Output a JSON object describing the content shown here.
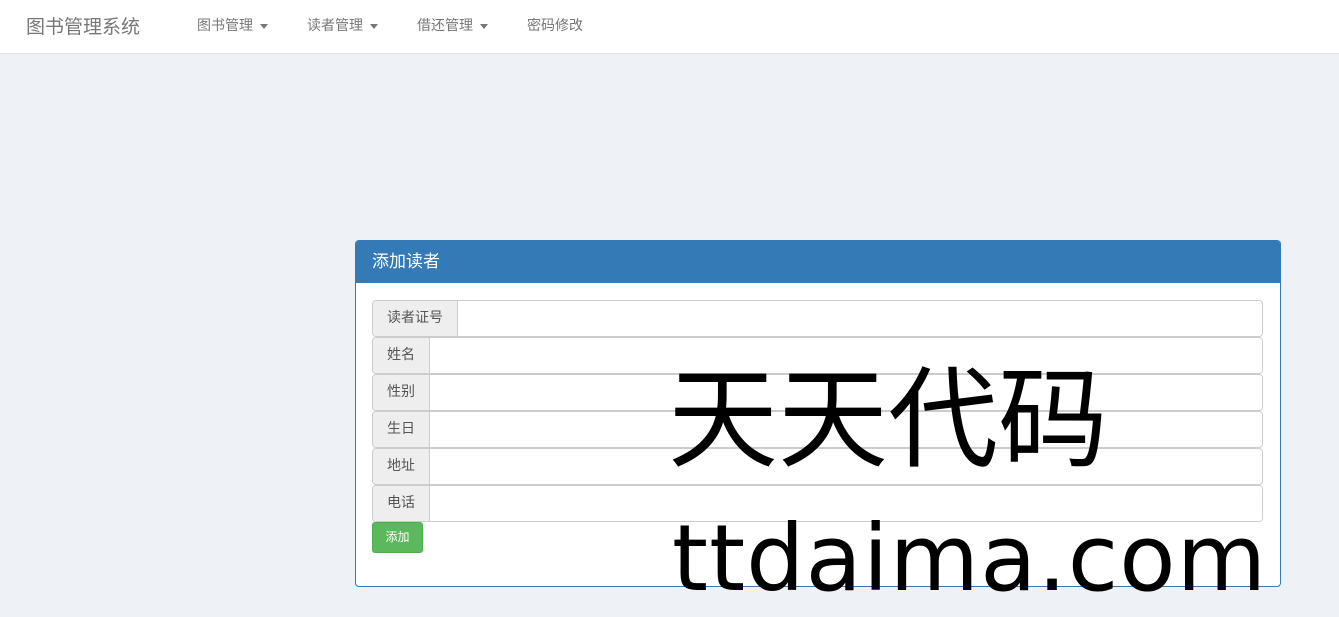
{
  "navbar": {
    "brand": "图书管理系统",
    "items": [
      {
        "label": "图书管理",
        "dropdown": true
      },
      {
        "label": "读者管理",
        "dropdown": true
      },
      {
        "label": "借还管理",
        "dropdown": true
      },
      {
        "label": "密码修改",
        "dropdown": false
      }
    ]
  },
  "panel": {
    "title": "添加读者",
    "fields": [
      {
        "label": "读者证号",
        "value": ""
      },
      {
        "label": "姓名",
        "value": ""
      },
      {
        "label": "性别",
        "value": ""
      },
      {
        "label": "生日",
        "value": ""
      },
      {
        "label": "地址",
        "value": ""
      },
      {
        "label": "电话",
        "value": ""
      }
    ],
    "submit_label": "添加"
  },
  "watermark": {
    "chinese": "天天代码",
    "url": "ttdaima.com"
  },
  "colors": {
    "primary": "#337ab7",
    "success": "#5cb85c",
    "background": "#eef1f6"
  }
}
